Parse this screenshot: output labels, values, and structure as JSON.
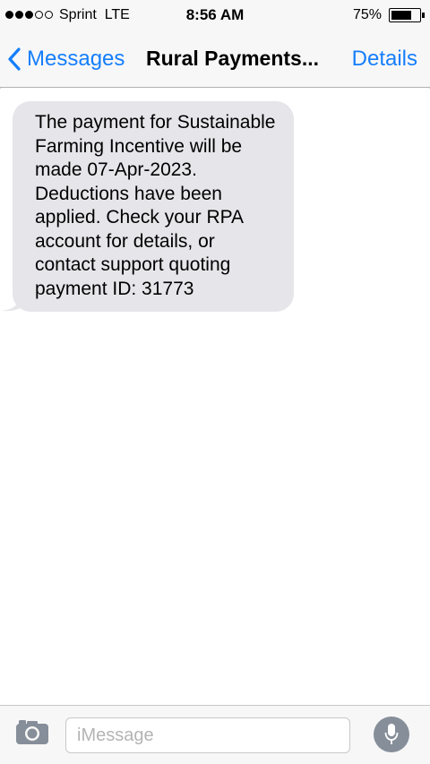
{
  "status_bar": {
    "signal_dots_filled": 3,
    "signal_dots_total": 5,
    "carrier": "Sprint",
    "network": "LTE",
    "time": "8:56 AM",
    "battery_percent_label": "75%",
    "battery_level": 0.75
  },
  "nav": {
    "back_label": "Messages",
    "title": "Rural Payments...",
    "details_label": "Details"
  },
  "messages": [
    {
      "direction": "incoming",
      "text": "The payment for Sustainable Farming Incentive will be made 07-Apr-2023. Deductions have been applied. Check your RPA account for details, or contact support quoting payment ID: 31773"
    }
  ],
  "input": {
    "placeholder": "iMessage"
  },
  "colors": {
    "accent": "#157efb",
    "incoming_bubble": "#e5e5ea",
    "bar_background": "#f7f7f7",
    "mic_button": "#858e99"
  },
  "icons": {
    "back": "chevron-left-icon",
    "camera": "camera-icon",
    "mic": "microphone-icon",
    "battery": "battery-icon"
  }
}
